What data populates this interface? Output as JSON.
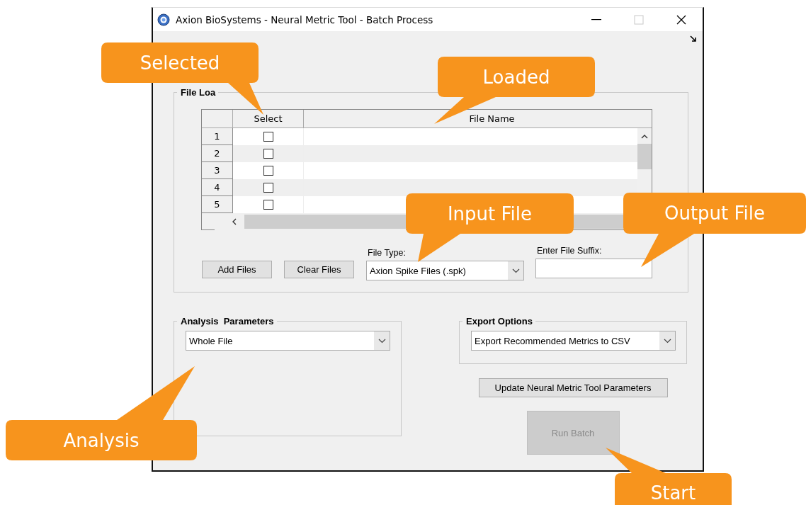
{
  "window": {
    "title": "Axion BioSystems - Neural Metric Tool - Batch Process"
  },
  "file_loading": {
    "label": "File Loa",
    "table": {
      "columns": [
        "Select",
        "File Name"
      ],
      "rows": [
        {
          "number": "1",
          "checked": false
        },
        {
          "number": "2",
          "checked": false
        },
        {
          "number": "3",
          "checked": false
        },
        {
          "number": "4",
          "checked": false
        },
        {
          "number": "5",
          "checked": false
        }
      ]
    },
    "add_button": "Add Files",
    "clear_button": "Clear Files",
    "file_type": {
      "label": "File Type:",
      "value": "Axion Spike Files (.spk)"
    },
    "suffix": {
      "label": "Enter File Suffix:"
    }
  },
  "analysis_parameters": {
    "label": "Analysis  Parameters",
    "value": "Whole File"
  },
  "export_options": {
    "label": "Export Options",
    "value": "Export Recommended Metrics to CSV"
  },
  "update_button": "Update Neural Metric Tool Parameters",
  "run_batch": {
    "label": "Run Batch",
    "disabled": true
  },
  "callouts": [
    {
      "text": "Selected"
    },
    {
      "text": "Loaded"
    },
    {
      "text": "Input File"
    },
    {
      "text": "Output File"
    },
    {
      "text": "Analysis"
    },
    {
      "text": "Start"
    }
  ]
}
